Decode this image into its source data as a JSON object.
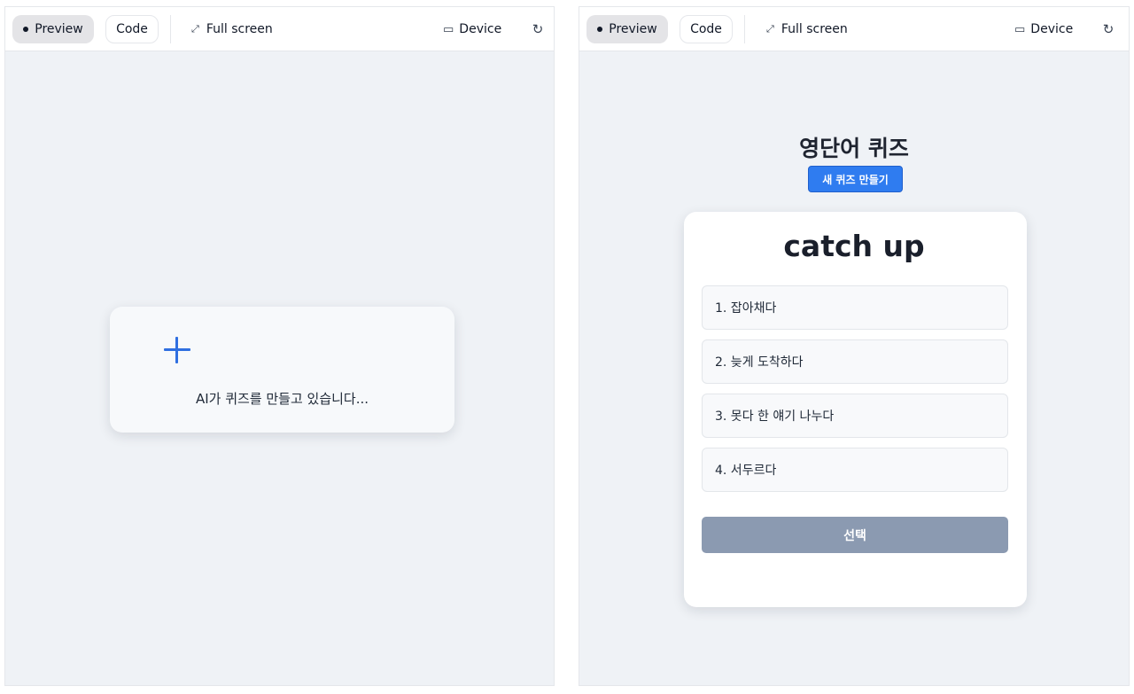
{
  "toolbar": {
    "preview_label": "Preview",
    "code_label": "Code",
    "fullscreen_label": "Full screen",
    "device_label": "Device"
  },
  "icons": {
    "preview": "dot-icon",
    "fullscreen": "expand-icon",
    "device": "device-icon",
    "refresh": "refresh-icon",
    "loading": "plus-icon"
  },
  "left": {
    "loading_text": "AI가 퀴즈를 만들고 있습니다..."
  },
  "right": {
    "title": "영단어 퀴즈",
    "new_quiz_label": "새 퀴즈 만들기",
    "word": "catch up",
    "options": [
      "1. 잡아채다",
      "2. 늦게 도착하다",
      "3. 못다 한 얘기 나누다",
      "4. 서두르다"
    ],
    "select_label": "선택"
  },
  "colors": {
    "accent": "#2f7cf0",
    "disabled_button": "#8b9ab1",
    "canvas": "#eff2f6"
  }
}
